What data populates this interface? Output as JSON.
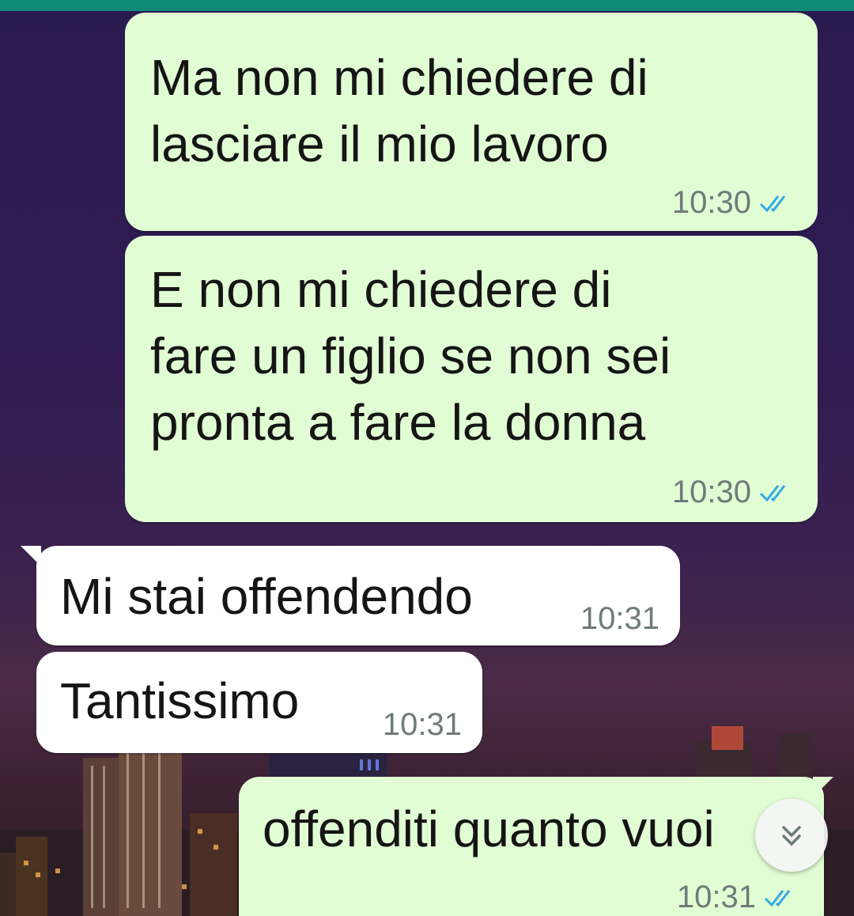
{
  "messages": [
    {
      "direction": "outgoing",
      "text": "Ma non mi chiedere di\nlasciare il mio lavoro",
      "time": "10:30",
      "status": "read"
    },
    {
      "direction": "outgoing",
      "text": "E non mi chiedere di\nfare un figlio se non sei\npronta a fare la donna",
      "time": "10:30",
      "status": "read"
    },
    {
      "direction": "incoming",
      "text": "Mi stai offendendo",
      "time": "10:31"
    },
    {
      "direction": "incoming",
      "text": "Tantissimo",
      "time": "10:31"
    },
    {
      "direction": "outgoing",
      "text": "offenditi quanto vuoi",
      "time": "10:31",
      "status": "read"
    }
  ],
  "icons": {
    "read_ticks": "double-check-icon",
    "scroll_down": "double-chevron-down-icon"
  },
  "colors": {
    "header": "#0f8a76",
    "outgoing_bubble": "#e1fdd4",
    "incoming_bubble": "#ffffff",
    "read_tick": "#34a8e5"
  }
}
